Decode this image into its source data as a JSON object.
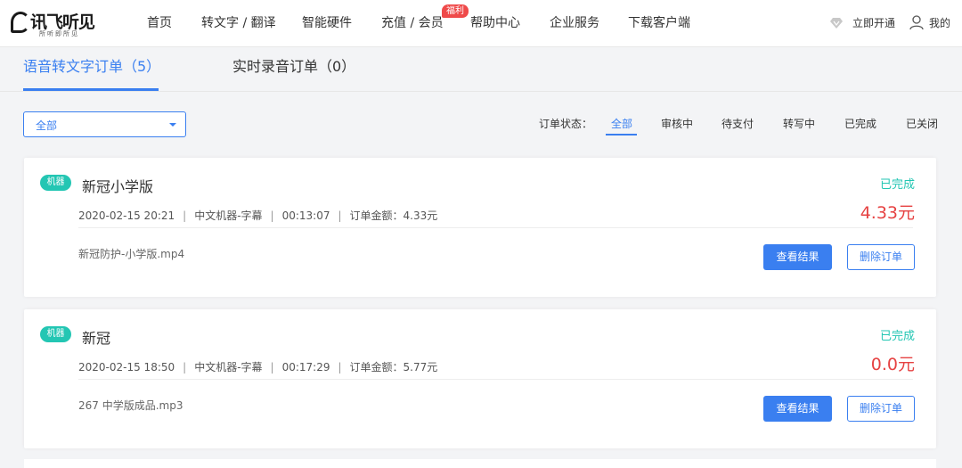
{
  "brand": {
    "name": "讯飞听见",
    "tagline": "所听即所见"
  },
  "nav": {
    "items": [
      {
        "label": "首页"
      },
      {
        "label": "转文字 / 翻译"
      },
      {
        "label": "智能硬件"
      },
      {
        "label": "充值 / 会员"
      },
      {
        "label": "帮助中心"
      },
      {
        "label": "企业服务"
      },
      {
        "label": "下载客户端"
      }
    ],
    "badge": "福利",
    "upgrade_label": "立即开通",
    "account_label": "我的"
  },
  "tabs": [
    {
      "label": "语音转文字订单（5）",
      "active": true
    },
    {
      "label": "实时录音订单（0）",
      "active": false
    }
  ],
  "filter": {
    "dropdown_value": "全部",
    "status_label": "订单状态：",
    "options": [
      {
        "label": "全部",
        "active": true
      },
      {
        "label": "审核中"
      },
      {
        "label": "待支付"
      },
      {
        "label": "转写中"
      },
      {
        "label": "已完成"
      },
      {
        "label": "已关闭"
      }
    ]
  },
  "orders": [
    {
      "tag": "机器",
      "title": "新冠小学版",
      "datetime": "2020-02-15 20:21",
      "service": "中文机器-字幕",
      "duration": "00:13:07",
      "amount_text": "订单金额：4.33元",
      "file": "新冠防护-小学版.mp4",
      "status": "已完成",
      "amount": "4.33元",
      "view_label": "查看结果",
      "delete_label": "删除订单"
    },
    {
      "tag": "机器",
      "title": "新冠",
      "datetime": "2020-02-15 18:50",
      "service": "中文机器-字幕",
      "duration": "00:17:29",
      "amount_text": "订单金额：5.77元",
      "file": "267 中学版成品.mp3",
      "status": "已完成",
      "amount": "0.0元",
      "view_label": "查看结果",
      "delete_label": "删除订单"
    }
  ],
  "colors": {
    "accent": "#3a7ff0",
    "tag": "#23c6b3",
    "status_done": "#23c6b3",
    "amount": "#e64242",
    "badge": "#ef4a4a"
  }
}
